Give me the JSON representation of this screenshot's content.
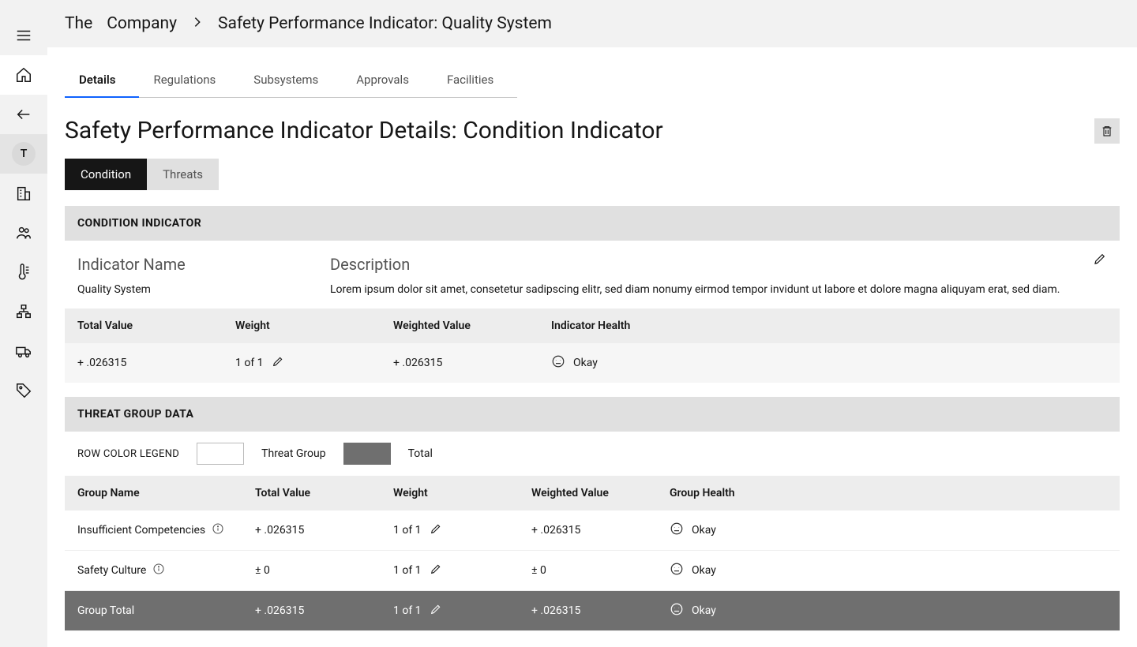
{
  "breadcrumb": {
    "root": "The",
    "company": "Company",
    "current": "Safety Performance Indicator: Quality System"
  },
  "avatar_letter": "T",
  "tabs": [
    {
      "label": "Details"
    },
    {
      "label": "Regulations"
    },
    {
      "label": "Subsystems"
    },
    {
      "label": "Approvals"
    },
    {
      "label": "Facilities"
    }
  ],
  "page_title": "Safety Performance Indicator Details: Condition Indicator",
  "segmented": {
    "condition": "Condition",
    "threats": "Threats"
  },
  "condition_panel": {
    "header": "CONDITION INDICATOR",
    "name_label": "Indicator Name",
    "name_value": "Quality System",
    "desc_label": "Description",
    "desc_value": "Lorem ipsum dolor sit amet, consetetur sadipscing elitr, sed diam nonumy eirmod tempor invidunt ut labore et dolore magna aliquyam erat, sed diam.",
    "metrics_head": {
      "total_value": "Total Value",
      "weight": "Weight",
      "weighted_value": "Weighted Value",
      "health": "Indicator Health"
    },
    "metrics": {
      "total_value": "+ .026315",
      "weight": "1 of 1",
      "weighted_value": "+ .026315",
      "health": "Okay"
    }
  },
  "threat_panel": {
    "header": "THREAT GROUP DATA",
    "legend_label": "ROW COLOR LEGEND",
    "legend_threat": "Threat Group",
    "legend_total": "Total",
    "head": {
      "group_name": "Group Name",
      "total_value": "Total Value",
      "weight": "Weight",
      "weighted_value": "Weighted Value",
      "group_health": "Group Health"
    },
    "rows": [
      {
        "name": "Insufficient Competencies",
        "total_value": "+ .026315",
        "weight": "1 of 1",
        "weighted_value": "+ .026315",
        "health": "Okay"
      },
      {
        "name": "Safety Culture",
        "total_value": "± 0",
        "weight": "1 of 1",
        "weighted_value": "± 0",
        "health": "Okay"
      }
    ],
    "total_row": {
      "name": "Group Total",
      "total_value": "+ .026315",
      "weight": "1 of 1",
      "weighted_value": "+ .026315",
      "health": "Okay"
    }
  }
}
